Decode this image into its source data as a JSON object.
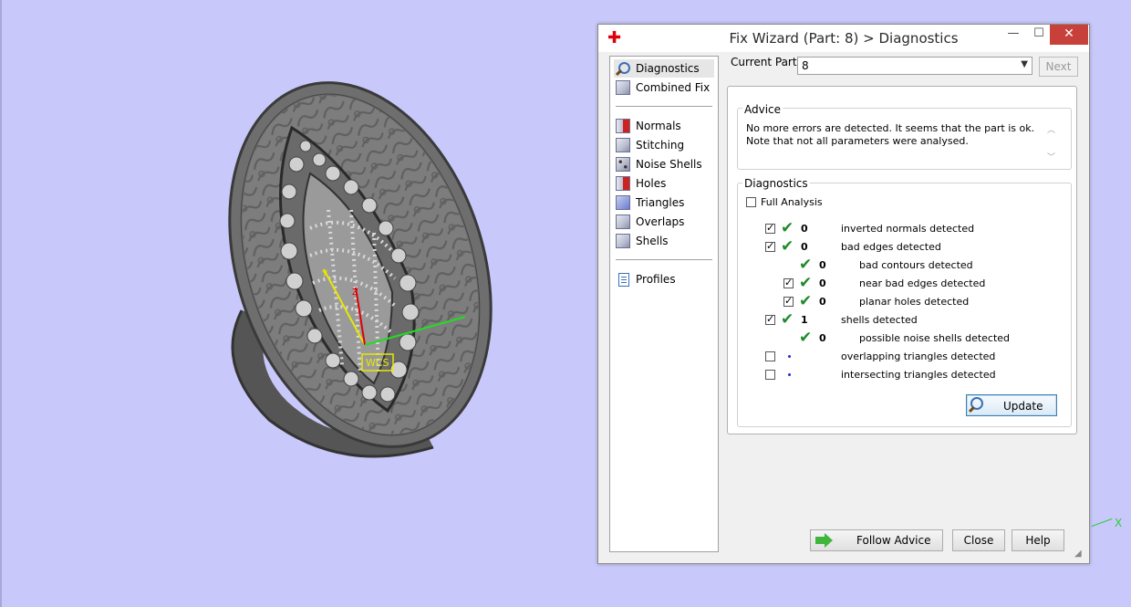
{
  "viewport": {
    "wcs_label": "WCS",
    "axis_x_label": "X",
    "colors": {
      "background": "#c8c8fa",
      "axis_x": "#2ecc40",
      "axis_y": "#e8e800",
      "axis_z": "#e00000"
    }
  },
  "dialog": {
    "title": "Fix Wizard (Part: 8) > Diagnostics",
    "app_icon": "red-cross-icon",
    "window_buttons": {
      "minimize": "—",
      "maximize": "☐",
      "close": "✕"
    },
    "nav": {
      "group1": [
        {
          "label": "Diagnostics",
          "icon": "magnifier-icon",
          "selected": true
        },
        {
          "label": "Combined Fix",
          "icon": "cube-icon"
        }
      ],
      "group2": [
        {
          "label": "Normals",
          "icon": "normals-cube-icon"
        },
        {
          "label": "Stitching",
          "icon": "stitching-cube-icon"
        },
        {
          "label": "Noise Shells",
          "icon": "noise-shells-cube-icon"
        },
        {
          "label": "Holes",
          "icon": "holes-cube-icon"
        },
        {
          "label": "Triangles",
          "icon": "triangles-cube-icon"
        },
        {
          "label": "Overlaps",
          "icon": "overlaps-cube-icon"
        },
        {
          "label": "Shells",
          "icon": "shells-cube-icon"
        }
      ],
      "group3": [
        {
          "label": "Profiles",
          "icon": "profiles-document-icon"
        }
      ]
    },
    "current_part": {
      "label": "Current Part:",
      "value": "8",
      "next_label": "Next"
    },
    "advice": {
      "title": "Advice",
      "text": "No more errors are detected. It seems that the part is ok. Note that not all parameters were analysed."
    },
    "diagnostics": {
      "title": "Diagnostics",
      "full_analysis_label": "Full Analysis",
      "full_analysis_checked": false,
      "rows": [
        {
          "checked": true,
          "status": "ok",
          "count": "0",
          "label": "inverted normals detected",
          "indent": 0,
          "has_checkbox": true
        },
        {
          "checked": true,
          "status": "ok",
          "count": "0",
          "label": "bad edges detected",
          "indent": 0,
          "has_checkbox": true
        },
        {
          "checked": false,
          "status": "ok",
          "count": "0",
          "label": "bad contours detected",
          "indent": 1,
          "has_checkbox": false
        },
        {
          "checked": true,
          "status": "ok",
          "count": "0",
          "label": "near bad edges detected",
          "indent": 1,
          "has_checkbox": true
        },
        {
          "checked": true,
          "status": "ok",
          "count": "0",
          "label": "planar holes detected",
          "indent": 1,
          "has_checkbox": true
        },
        {
          "checked": true,
          "status": "ok",
          "count": "1",
          "label": "shells detected",
          "indent": 0,
          "has_checkbox": true
        },
        {
          "checked": false,
          "status": "ok",
          "count": "0",
          "label": "possible noise shells detected",
          "indent": 1,
          "has_checkbox": false
        },
        {
          "checked": false,
          "status": "none",
          "count": "",
          "label": "overlapping triangles detected",
          "indent": 0,
          "has_checkbox": true
        },
        {
          "checked": false,
          "status": "none",
          "count": "",
          "label": "intersecting triangles detected",
          "indent": 0,
          "has_checkbox": true
        }
      ],
      "update_label": "Update"
    },
    "buttons": {
      "follow_advice": "Follow Advice",
      "close": "Close",
      "help": "Help"
    }
  }
}
